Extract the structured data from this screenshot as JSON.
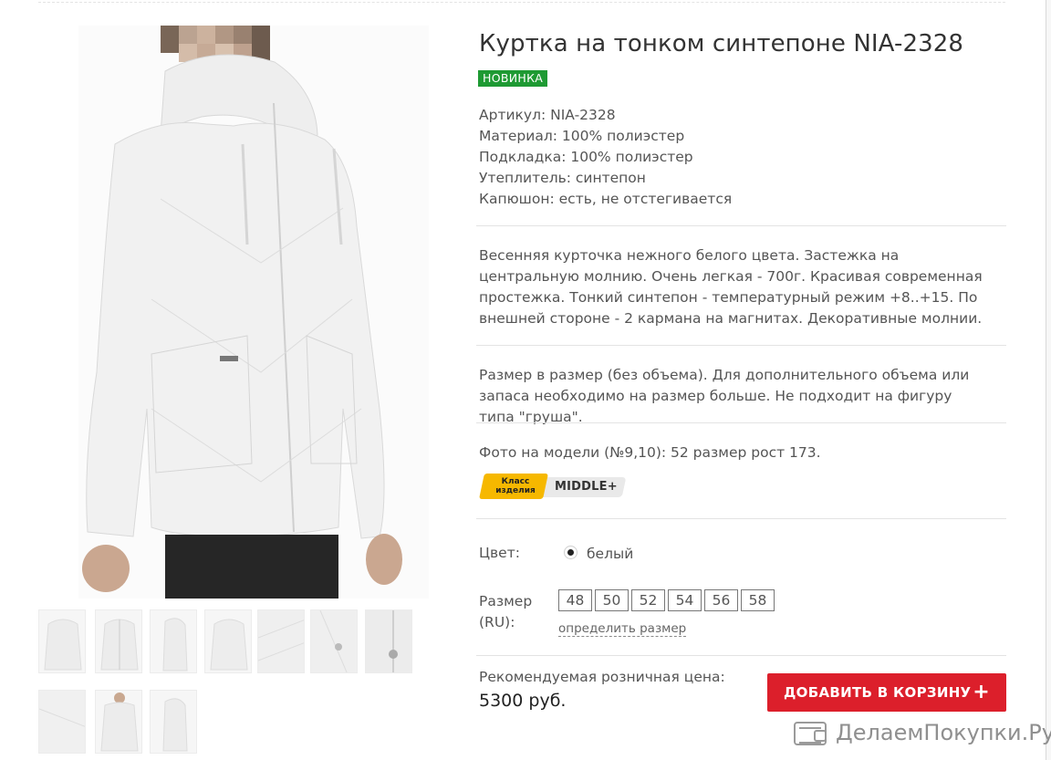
{
  "product": {
    "title": "Куртка на тонком синтепоне NIA-2328",
    "badge": "НОВИНКА",
    "specs": [
      "Артикул: NIA-2328",
      "Материал: 100% полиэстер",
      "Подкладка: 100% полиэстер",
      "Утеплитель: синтепон",
      "Капюшон: есть, не отстегивается"
    ],
    "description": "Весенняя курточка нежного белого цвета. Застежка на центральную молнию. Очень легкая - 700г. Красивая современная простежка. Тонкий синтепон  - температурный режим +8..+15. По внешней стороне - 2 кармана на магнитах. Декоративные молнии.",
    "size_note": "Размер в размер (без объема). Для дополнительного объема или запаса необходимо на размер больше. Не подходит на фигуру типа \"груша\".",
    "model_note": "Фото на модели (№9,10): 52 размер рост 173.",
    "class_badge": {
      "label_line1": "Класс",
      "label_line2": "изделия",
      "value": "MIDDLE+"
    },
    "color": {
      "label": "Цвет:",
      "selected": "белый"
    },
    "size": {
      "label_line1": "Размер",
      "label_line2": "(RU):",
      "options": [
        "48",
        "50",
        "52",
        "54",
        "56",
        "58"
      ],
      "help_link": "определить размер"
    },
    "price": {
      "label": "Рекомендуемая розничная цена:",
      "value": "5300 руб."
    },
    "cart_button": "ДОБАВИТЬ В КОРЗИНУ",
    "cart_plus": "+"
  },
  "watermark": {
    "text": "ДелаемПокупки.Ру",
    "icon": "wallet-icon"
  },
  "gallery": {
    "jacket_color": "#f2f2f2",
    "thumbnail_count": 10
  }
}
